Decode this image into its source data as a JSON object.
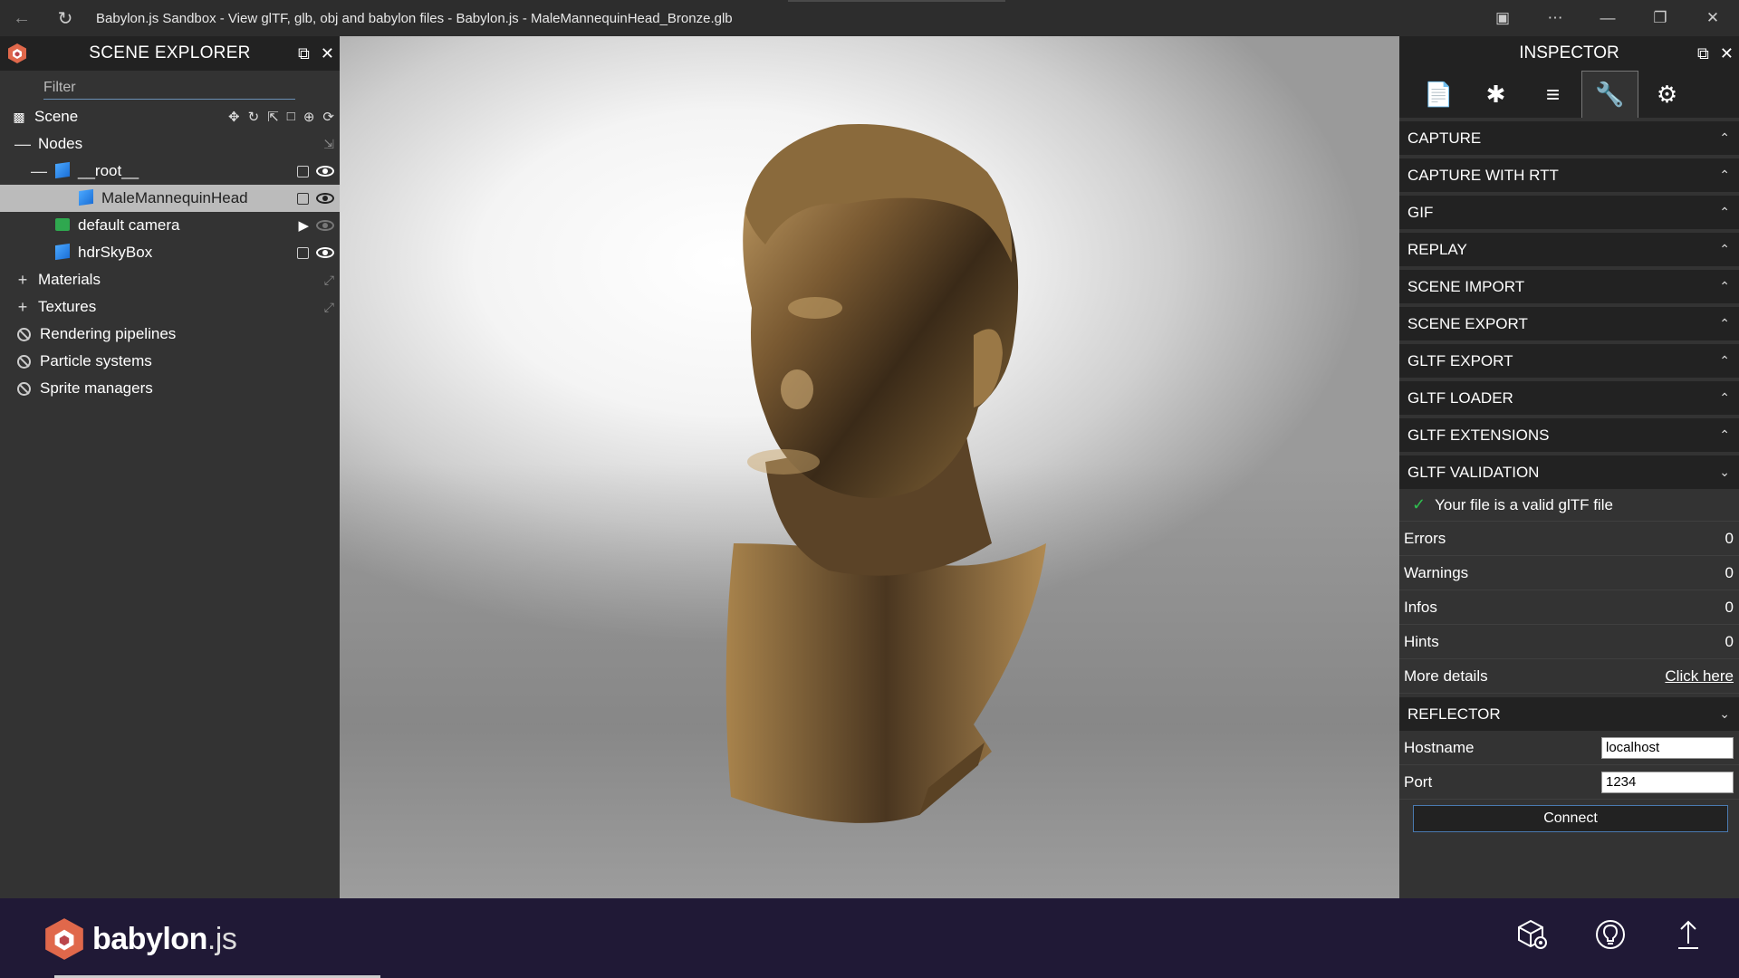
{
  "window": {
    "title": "Babylon.js Sandbox - View glTF, glb, obj and babylon files - Babylon.js - MaleMannequinHead_Bronze.glb"
  },
  "explorer": {
    "title": "SCENE EXPLORER",
    "filter_placeholder": "Filter",
    "scene_label": "Scene",
    "nodes_label": "Nodes",
    "root_label": "__root__",
    "mesh_label": "MaleMannequinHead",
    "camera_label": "default camera",
    "skybox_label": "hdrSkyBox",
    "materials_label": "Materials",
    "textures_label": "Textures",
    "rendering_label": "Rendering pipelines",
    "particles_label": "Particle systems",
    "sprites_label": "Sprite managers"
  },
  "inspector": {
    "title": "INSPECTOR",
    "tabs": [
      "properties",
      "debug",
      "statistics",
      "tools",
      "settings"
    ],
    "active_tab": "tools",
    "sections": {
      "capture": "CAPTURE",
      "capture_rtt": "CAPTURE WITH RTT",
      "gif": "GIF",
      "replay": "REPLAY",
      "scene_import": "SCENE IMPORT",
      "scene_export": "SCENE EXPORT",
      "gltf_export": "GLTF EXPORT",
      "gltf_loader": "GLTF LOADER",
      "gltf_extensions": "GLTF EXTENSIONS",
      "gltf_validation": "GLTF VALIDATION",
      "reflector": "REFLECTOR"
    },
    "validation": {
      "message": "Your file is a valid glTF file",
      "errors_label": "Errors",
      "errors": "0",
      "warnings_label": "Warnings",
      "warnings": "0",
      "infos_label": "Infos",
      "infos": "0",
      "hints_label": "Hints",
      "hints": "0",
      "details_label": "More details",
      "details_link": "Click here"
    },
    "reflector": {
      "hostname_label": "Hostname",
      "hostname": "localhost",
      "port_label": "Port",
      "port": "1234",
      "connect_label": "Connect"
    }
  },
  "bottombar": {
    "logo_bold": "babylon",
    "logo_light": ".js"
  },
  "colors": {
    "panel": "#333333",
    "header": "#222222",
    "bottombar": "#201936",
    "accent_green": "#2fbf4f"
  }
}
